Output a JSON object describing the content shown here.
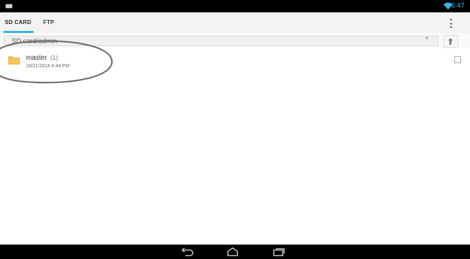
{
  "status_bar": {
    "time": "6:47",
    "icons": [
      "notification-icon",
      "wifi-icon"
    ]
  },
  "tabs": [
    {
      "label": "SD CARD",
      "selected": true
    },
    {
      "label": "FTP",
      "selected": false
    }
  ],
  "path_bar": {
    "path": "SD card/admin"
  },
  "file_list": [
    {
      "name": "master",
      "count": "(1)",
      "date": "10/21/2014 6:44 PM",
      "icon": "folder-icon"
    }
  ],
  "navigation": {
    "buttons": [
      "back-icon",
      "home-icon",
      "recent-apps-icon"
    ]
  },
  "colors": {
    "accent": "#33b5e5",
    "folder": "#f0b44a",
    "annotation": "#707070"
  }
}
